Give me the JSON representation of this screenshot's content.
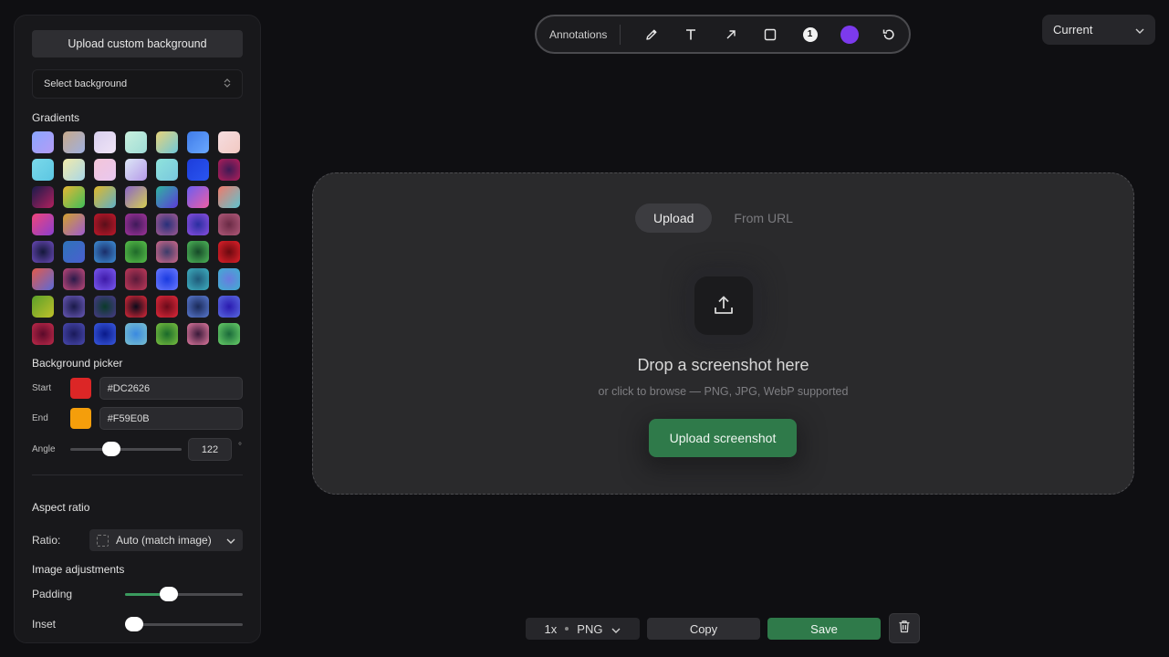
{
  "sidebar": {
    "upload_background_label": "Upload custom background",
    "select_background_label": "Select background",
    "gradients_label": "Gradients",
    "gradients": [
      "linear-gradient(135deg,#8aa6ff,#b49cf5)",
      "linear-gradient(135deg,#c7a98a,#9fb0e0)",
      "linear-gradient(135deg,#d8cfee,#f0e4f7)",
      "linear-gradient(135deg,#c9f0de,#9fdcd6)",
      "linear-gradient(135deg,#e7d37a,#6fc7d9)",
      "linear-gradient(135deg,#3f7be8,#6aa8ff)",
      "linear-gradient(135deg,#f6dde0,#f2c9c2)",
      "linear-gradient(135deg,#7ad9ea,#5cc6e2)",
      "linear-gradient(135deg,#f2eaaa,#a8d7e8)",
      "linear-gradient(135deg,#f4c6d8,#e8c7f0)",
      "linear-gradient(135deg,#dde7f7,#b59ae8)",
      "linear-gradient(135deg,#8fe3dc,#79c7de)",
      "linear-gradient(135deg,#1d3ddb,#2a55f0)",
      "radial-gradient(circle,#3d1a55,#b21e5a)",
      "linear-gradient(135deg,#191b4a,#b2205e)",
      "linear-gradient(135deg,#e6b634,#3fbf59)",
      "linear-gradient(135deg,#e0b82a,#5fb0c7)",
      "linear-gradient(135deg,#8a65c8,#d6cf52)",
      "linear-gradient(135deg,#2fb5a0,#5b3bd8)",
      "linear-gradient(135deg,#6a5ef0,#ee5ea6)",
      "linear-gradient(135deg,#f07a6a,#5fc4d0)",
      "linear-gradient(135deg,#f0457a,#8a3fd0)",
      "linear-gradient(135deg,#d1a02e,#9e5bd0)",
      "radial-gradient(circle,#5a0f1a,#c0182a)",
      "radial-gradient(circle,#3f1a5a,#a0349a)",
      "radial-gradient(circle,#282f7a,#a05b92)",
      "radial-gradient(circle,#2a2ea0,#8a4fe0)",
      "radial-gradient(circle,#6a2a45,#b05a7a)",
      "radial-gradient(circle,#14183a,#6a4ab8)",
      "linear-gradient(135deg,#2e74b8,#4a5fd0)",
      "radial-gradient(circle,#1a2e6a,#3f8fd6)",
      "radial-gradient(circle,#1f6a2a,#59c04a)",
      "radial-gradient(circle,#3b3b6a,#d06a8a)",
      "radial-gradient(circle,#164a28,#4fb85a)",
      "radial-gradient(circle,#6a0a10,#e0202a)",
      "linear-gradient(135deg,#e25a4a,#5b6ad8)",
      "radial-gradient(circle,#2a1a4a,#c04a7a)",
      "radial-gradient(circle,#3e1aa8,#7a5af0)",
      "radial-gradient(circle,#5a1a3a,#c03a5a)",
      "radial-gradient(circle,#1a3ae0,#6a7aff)",
      "radial-gradient(circle,#1f5a7a,#3fb0c0)",
      "radial-gradient(circle,#6a7ae0,#3fb0d0)",
      "linear-gradient(135deg,#5aa02a,#c0c02a)",
      "radial-gradient(circle,#1a1a4a,#6a5ab8)",
      "radial-gradient(circle,#0a3a2a,#4a3a8a)",
      "radial-gradient(circle,#0a0a1a,#e02a3a)",
      "radial-gradient(circle,#6a0a1a,#e02a3a)",
      "radial-gradient(circle,#1a2a5a,#5a7ad0)",
      "radial-gradient(circle,#2a1ab0,#5a6ae0)",
      "radial-gradient(circle,#5a0a2a,#c02a4a)",
      "radial-gradient(circle,#1a1a5a,#4a4ab0)",
      "radial-gradient(circle,#0a1a8a,#3a5ae0)",
      "radial-gradient(circle,#3a8ae0,#7ac0d0)",
      "radial-gradient(circle,#1a6a2a,#7ac040)",
      "radial-gradient(circle,#3a1a3a,#e07aa0)",
      "radial-gradient(circle,#1a6a3a,#6ad06a)"
    ],
    "background_picker_label": "Background picker",
    "start_label": "Start",
    "start_color": "#DC2626",
    "end_label": "End",
    "end_color": "#F59E0B",
    "angle_label": "Angle",
    "angle_value": "122",
    "angle_unit": "°",
    "aspect_ratio_label": "Aspect ratio",
    "ratio_label": "Ratio:",
    "ratio_value": "Auto (match image)",
    "image_adjustments_label": "Image adjustments",
    "padding_label": "Padding",
    "padding_level": 0.35,
    "inset_label": "Inset",
    "inset_level": 0.0,
    "angle_level": 0.34
  },
  "toolbar": {
    "annotations_label": "Annotations",
    "tools": [
      "pencil-icon",
      "text-icon",
      "arrow-icon",
      "rectangle-icon",
      "number-badge-icon",
      "color-swatch",
      "undo-icon"
    ],
    "number_badge": "1",
    "active_color": "#7C3AED"
  },
  "version": {
    "label": "Current"
  },
  "dropzone": {
    "tab_upload": "Upload",
    "tab_from_url": "From URL",
    "title": "Drop a screenshot here",
    "subtitle": "or click to browse — PNG, JPG, WebP supported",
    "upload_button": "Upload screenshot"
  },
  "bottom": {
    "scale": "1x",
    "format": "PNG",
    "copy_label": "Copy",
    "save_label": "Save"
  }
}
